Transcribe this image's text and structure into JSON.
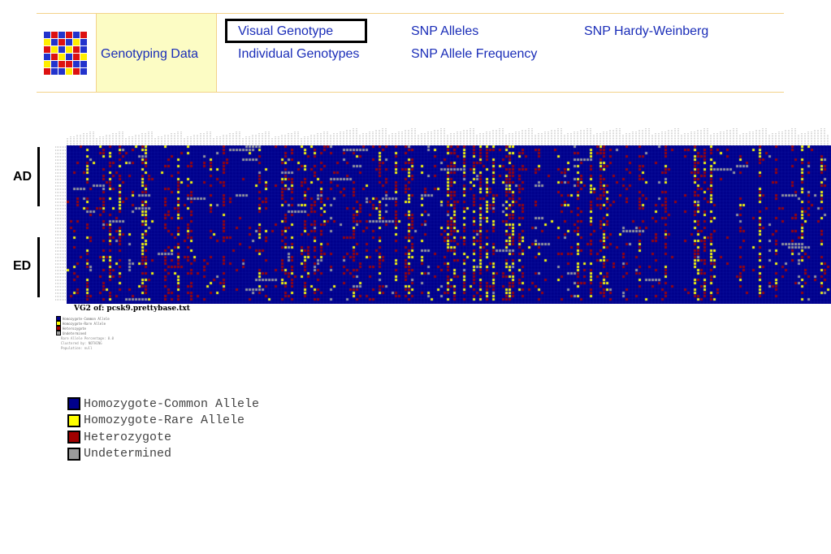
{
  "nav": {
    "title": "Genotyping Data",
    "links": {
      "visual_genotype": "Visual Genotype",
      "individual_genotypes": "Individual Genotypes",
      "snp_alleles": "SNP Alleles",
      "snp_allele_frequency": "SNP Allele Frequency",
      "snp_hardy_weinberg": "SNP Hardy-Weinberg"
    },
    "selected": "visual_genotype"
  },
  "groups": {
    "ad": "AD",
    "ed": "ED"
  },
  "grid": {
    "caption": "VG2 of: pcsk9.prettybase.txt",
    "rare_allele_percentage": "Rare Allele Percentage: 0.0",
    "clustered_by": "Clustered by: NOTHING",
    "population": "Population: null"
  },
  "legend": {
    "items": [
      {
        "label": "Homozygote-Common Allele",
        "color": "#00008b"
      },
      {
        "label": "Homozygote-Rare Allele",
        "color": "#ffff00"
      },
      {
        "label": "Heterozygote",
        "color": "#a00000"
      },
      {
        "label": "Undetermined",
        "color": "#9a9a9a"
      }
    ]
  },
  "logo_colors": [
    "#2233cc",
    "#dd1111",
    "#ffee00"
  ]
}
